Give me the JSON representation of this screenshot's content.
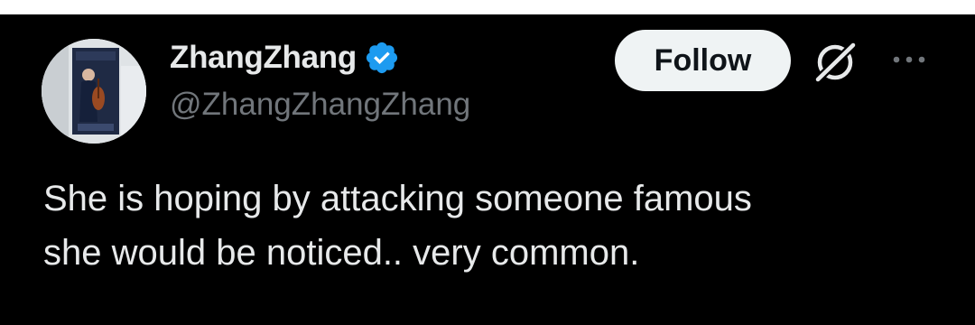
{
  "tweet": {
    "author": {
      "display_name": "ZhangZhang",
      "handle": "@ZhangZhangZhang",
      "verified": true,
      "verified_icon": "verified-badge-icon"
    },
    "actions": {
      "follow_label": "Follow",
      "grok_icon": "grok-icon",
      "more_icon": "more-options-icon"
    },
    "body": "She is hoping by attacking someone famous\nshe would be noticed.. very common."
  },
  "colors": {
    "background": "#000000",
    "text_primary": "#e7e9ea",
    "text_secondary": "#71767b",
    "verified_blue": "#1d9bf0",
    "follow_button_bg": "#eff3f4",
    "follow_button_text": "#0f1419"
  }
}
